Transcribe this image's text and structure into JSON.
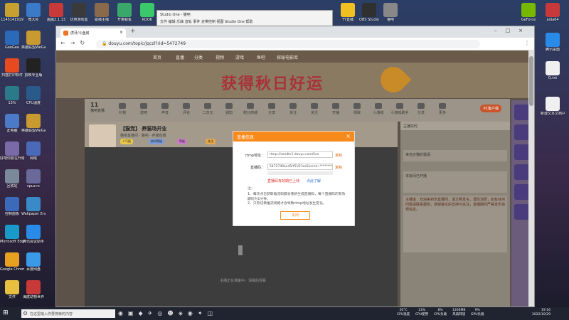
{
  "desktop": {
    "icons_left": [
      {
        "label": "1145141919",
        "color": "#c8a030"
      },
      {
        "label": "GeeGee",
        "color": "#2a6ab8"
      },
      {
        "label": "扫描打印软件",
        "color": "#e84a20"
      },
      {
        "label": "13%",
        "color": "#2a7a8a"
      },
      {
        "label": "此电脑",
        "color": "#4a7ac8"
      },
      {
        "label": "好吧你要在升级天之道",
        "color": "#7a6aa8"
      },
      {
        "label": "回收站",
        "color": "#7a8a9a"
      },
      {
        "label": "控制面板",
        "color": "#3a6ab8"
      },
      {
        "label": "Microsoft Edge",
        "color": "#1a9ac8"
      },
      {
        "label": "Google Chrome",
        "color": "#e8a020"
      },
      {
        "label": "文件",
        "color": "#e8c040"
      }
    ],
    "icons_col2": [
      {
        "label": "微大师",
        "color": "#3a7ac8"
      },
      {
        "label": "英雄联盟WeGame版",
        "color": "#c89a30"
      },
      {
        "label": "剪映专业版",
        "color": "#222222"
      },
      {
        "label": "CPU温度",
        "color": "#2a5a8a"
      },
      {
        "label": "英雄联盟WeGame版",
        "color": "#c89a30"
      },
      {
        "label": "网络",
        "color": "#4a6ab8"
      },
      {
        "label": "cpuz.rc",
        "color": "#6a6a9a"
      },
      {
        "label": "Wallpaper Engine：壁纸引擎",
        "color": "#3a8ac8"
      },
      {
        "label": "腾讯会议助手",
        "color": "#2a8ae8"
      },
      {
        "label": "百度网盘",
        "color": "#3a9ae8"
      },
      {
        "label": "海底动物世界",
        "color": "#c83a3a"
      }
    ],
    "top_icons": [
      {
        "label": "画画2.1.13",
        "color": "#c83a3a"
      },
      {
        "label": "优燕游戏盒",
        "color": "#3a3a3a"
      },
      {
        "label": "跟播主播",
        "color": "#8a6a4a"
      },
      {
        "label": "开着鲸鱼",
        "color": "#3aa86a"
      },
      {
        "label": "KOOK",
        "color": "#3ac86a"
      }
    ],
    "right_icons": [
      {
        "label": "GeForce",
        "color": "#76b900"
      },
      {
        "label": "aida64",
        "color": "#c83a3a"
      },
      {
        "label": "腾讯桌面",
        "color": "#2a8ae8"
      },
      {
        "label": "Q.txt",
        "color": "#f0f0f0"
      },
      {
        "label": "新建文本文档(4).txt",
        "color": "#f0f0f0"
      }
    ],
    "top_right_icons": [
      {
        "label": "YY直播",
        "color": "#f0c020"
      },
      {
        "label": "OBS Studio",
        "color": "#303030"
      },
      {
        "label": "猫吧",
        "color": "#888888"
      }
    ]
  },
  "studio_window": {
    "title": "Studio One - 猫吧",
    "menu": [
      "文件",
      "编辑",
      "乐曲",
      "音轨",
      "事件",
      "走带控制",
      "视图",
      "Studio One",
      "帮助"
    ]
  },
  "browser": {
    "tab_title": "虎牙/斗鱼房",
    "url": "douyu.com/topic/jqczl?rid=5472749",
    "nav_icons": [
      "back-icon",
      "forward-icon",
      "refresh-icon",
      "lock-icon"
    ]
  },
  "site": {
    "nav": [
      "首页",
      "直播",
      "分类",
      "视频",
      "游戏",
      "鱼吧",
      "探秘电影库"
    ],
    "banner_text": "获得秋日好运",
    "rank_number": "11",
    "rank_label": "猫吧直播",
    "toolbar": [
      "礼物",
      "送吧",
      "声音",
      "评论",
      "二次元",
      "通知",
      "积分商城",
      "分享",
      "关注",
      "关注",
      "开播",
      "领取",
      "小游戏",
      "小游戏助手",
      "分享",
      "更多"
    ],
    "pc_chip": "PC客户端",
    "room_title": "【猫党】 养猫场开业",
    "room_sub": "猫吧直播间 · 猫吧 · 养猫直播",
    "chips": [
      "人气值",
      "房间等级",
      "等级",
      "关注"
    ],
    "video_loading": "主播正在准备中，请稍后观看",
    "side_top": "主播实时",
    "side_notice_title": "来自天猫的邀请",
    "side_chat": "主播说：欢迎来到本直播间，请文明发言，理性消费，如有任何问题请联系超管，感谢各位的支持与关注，直播期间严禁发布违规信息。",
    "side_item": "本房间已开播"
  },
  "dialog": {
    "title": "直播信息",
    "rtmp_label": "rtmp地址：",
    "rtmp_value": "rtmp://sendtc1.douyu.com/live",
    "key_label": "直播码：",
    "key_value": "5472749ovd5rf5U3?wsSecret=****************",
    "copy": "复制",
    "red_link": "直播码有效期已上线",
    "blue_link": "点此了解",
    "notes": [
      "注：",
      "1、每次点击获取推流码都会重新生成直播码，每个直播码的有效期均为1分钟。",
      "2、只有切换推流线路才会导致rtmp地址发生变化。"
    ],
    "close_btn": "关闭"
  },
  "taskbar": {
    "search_placeholder": "在这里输入你要搜索的内容",
    "stats": [
      {
        "v": "50°C",
        "l": "CPU温度"
      },
      {
        "v": "13%",
        "l": "CPU使用"
      },
      {
        "v": "8%",
        "l": "CPU负载"
      },
      {
        "v": "1266MB",
        "l": "风扇转速"
      },
      {
        "v": "9%",
        "l": "GPU负载"
      }
    ],
    "time": "19:16",
    "date": "2022/10/29"
  }
}
